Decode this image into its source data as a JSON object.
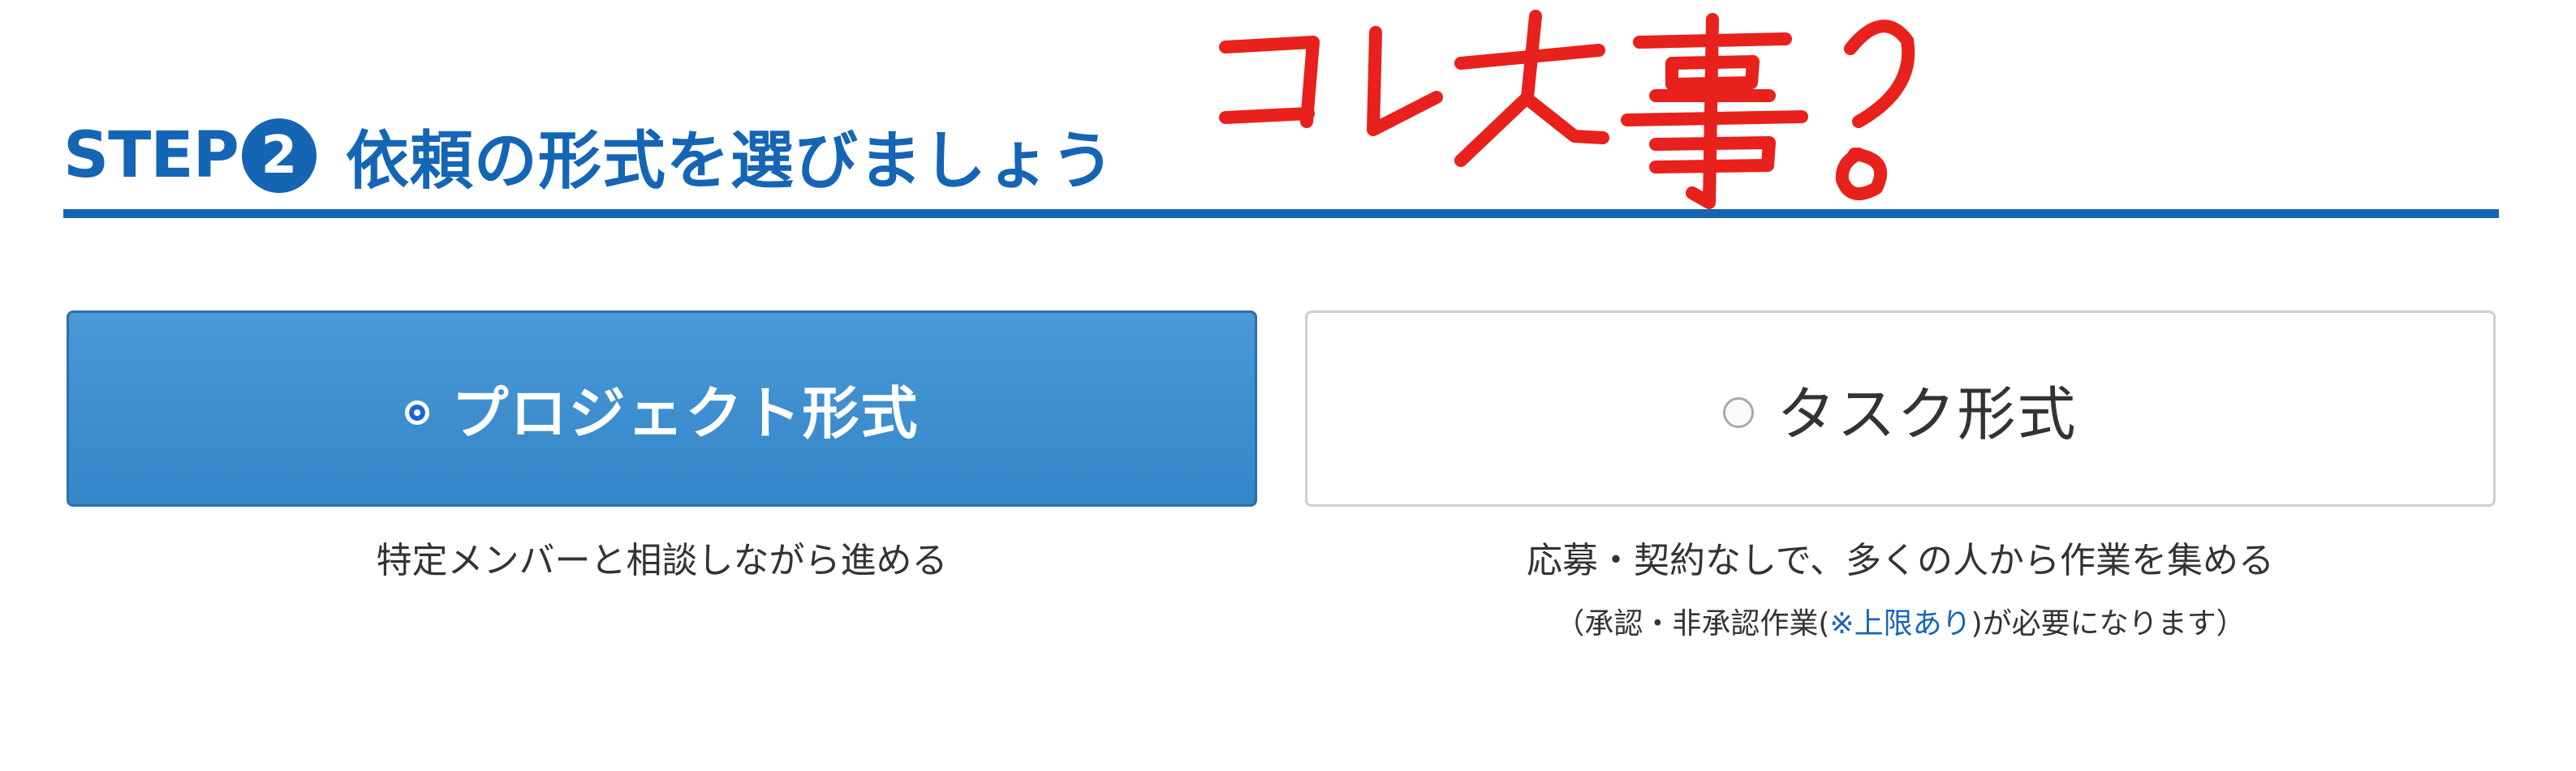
{
  "header": {
    "step_label": "STEP",
    "step_number": "2",
    "step_text": "依頼の形式を選びましょう"
  },
  "annotation": {
    "handwritten_text": "コレ大事!",
    "color": "#e8211c"
  },
  "options": {
    "project": {
      "label": "プロジェクト形式",
      "selected": true,
      "description": "特定メンバーと相談しながら進める"
    },
    "task": {
      "label": "タスク形式",
      "selected": false,
      "description": "応募・契約なしで、多くの人から作業を集める",
      "note_before": "（承認・非承認作業(",
      "note_link": "※上限あり",
      "note_after": ")が必要になります）"
    }
  },
  "colors": {
    "accent": "#1565b5",
    "selected_option": "#3d8fd1",
    "radio_selected": "#1a63d6"
  }
}
